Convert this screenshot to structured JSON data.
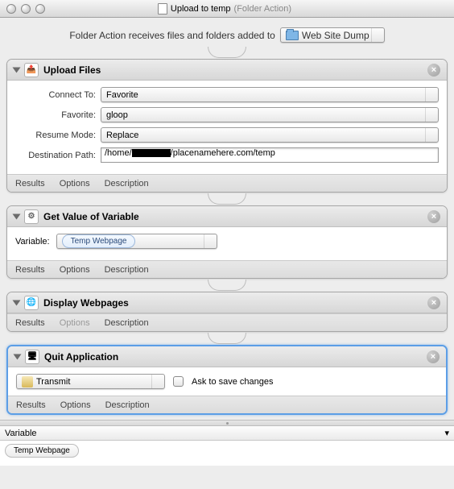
{
  "window": {
    "title": "Upload to temp",
    "subtitle": "(Folder Action)"
  },
  "header": {
    "text": "Folder Action receives files and folders added to",
    "folder": "Web Site Dump"
  },
  "actions": {
    "upload": {
      "title": "Upload Files",
      "connect_label": "Connect To:",
      "connect_value": "Favorite",
      "favorite_label": "Favorite:",
      "favorite_value": "gloop",
      "resume_label": "Resume Mode:",
      "resume_value": "Replace",
      "dest_label": "Destination Path:",
      "dest_prefix": "/home/",
      "dest_suffix": "/placenamehere.com/temp"
    },
    "getvar": {
      "title": "Get Value of Variable",
      "var_label": "Variable:",
      "var_value": "Temp Webpage"
    },
    "display": {
      "title": "Display Webpages"
    },
    "quit": {
      "title": "Quit Application",
      "app": "Transmit",
      "ask_label": "Ask to save changes"
    }
  },
  "footer": {
    "results": "Results",
    "options": "Options",
    "description": "Description"
  },
  "varpanel": {
    "header": "Variable",
    "item": "Temp Webpage"
  }
}
